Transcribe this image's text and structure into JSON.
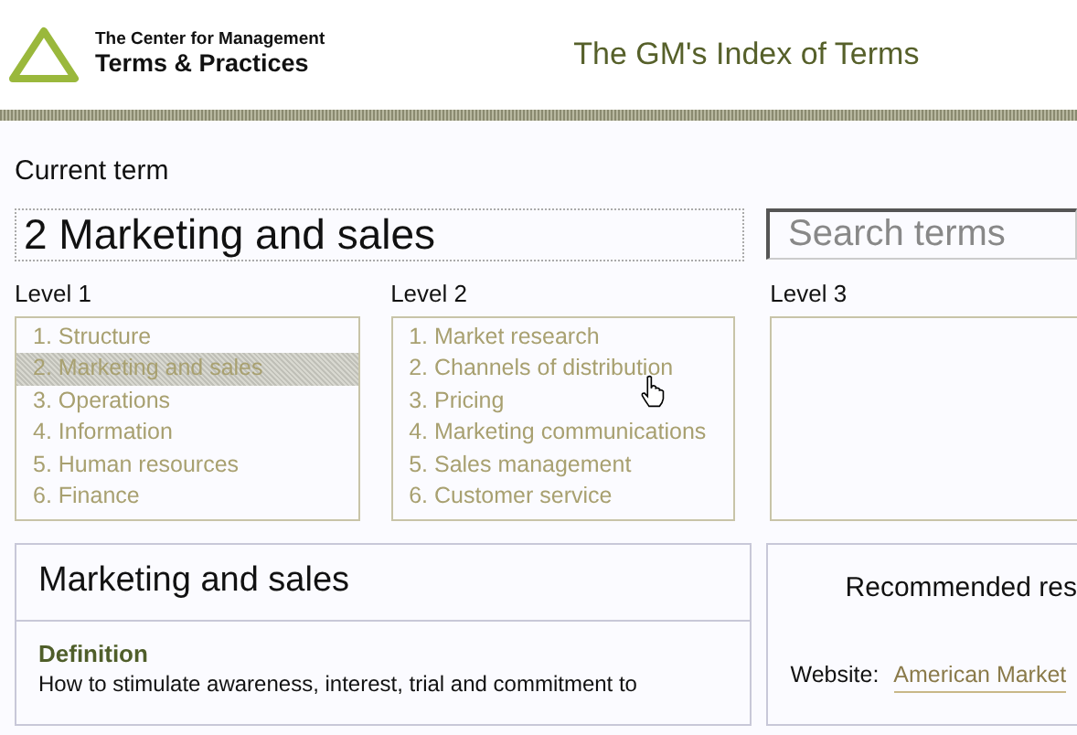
{
  "header": {
    "logo_line_1": "The Center for Management",
    "logo_line_2": "Terms & Practices",
    "title": "The GM's Index of Terms"
  },
  "current_term": {
    "label": "Current term",
    "value": "2 Marketing and sales"
  },
  "search": {
    "placeholder": "Search terms"
  },
  "levels": [
    {
      "label": "Level 1",
      "items": [
        {
          "text": "1. Structure",
          "selected": false
        },
        {
          "text": "2. Marketing and sales",
          "selected": true
        },
        {
          "text": "3. Operations",
          "selected": false
        },
        {
          "text": "4. Information",
          "selected": false
        },
        {
          "text": "5. Human resources",
          "selected": false
        },
        {
          "text": "6. Finance",
          "selected": false
        }
      ]
    },
    {
      "label": "Level 2",
      "items": [
        {
          "text": "1. Market research",
          "selected": false
        },
        {
          "text": "2. Channels of distribution",
          "selected": false
        },
        {
          "text": "3. Pricing",
          "selected": false
        },
        {
          "text": "4. Marketing communications",
          "selected": false
        },
        {
          "text": "5. Sales management",
          "selected": false
        },
        {
          "text": "6. Customer service",
          "selected": false
        }
      ]
    },
    {
      "label": "Level 3"
    }
  ],
  "term_panel": {
    "title": "Marketing and sales",
    "definition_heading": "Definition",
    "definition": "How to stimulate awareness, interest, trial and commitment to"
  },
  "resources_panel": {
    "title": "Recommended res",
    "website_label": "Website:",
    "website_link": "American Market"
  }
}
